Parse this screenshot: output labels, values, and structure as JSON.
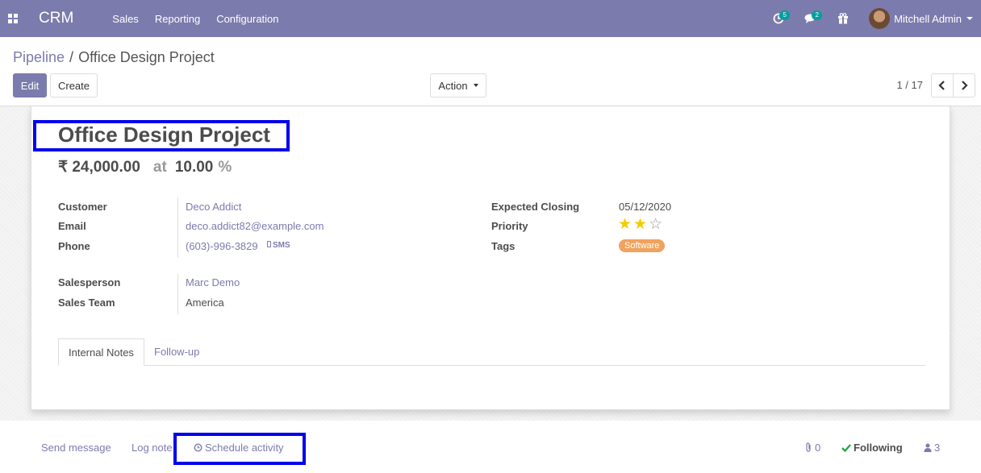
{
  "navbar": {
    "brand": "CRM",
    "menu": [
      "Sales",
      "Reporting",
      "Configuration"
    ],
    "activity_count": "5",
    "message_count": "2",
    "user_name": "Mitchell Admin"
  },
  "control": {
    "breadcrumb_parent": "Pipeline",
    "breadcrumb_separator": "/",
    "breadcrumb_current": "Office Design Project",
    "edit_label": "Edit",
    "create_label": "Create",
    "action_label": "Action",
    "pager": "1 / 17"
  },
  "record": {
    "title": "Office Design Project",
    "revenue": "₹ 24,000.00",
    "at_label": "at",
    "probability": "10.00",
    "percent_sign": "%",
    "left_fields": [
      {
        "label": "Customer",
        "value": "Deco Addict"
      },
      {
        "label": "Email",
        "value": "deco.addict82@example.com"
      },
      {
        "label": "Phone",
        "value": "(603)-996-3829"
      },
      {
        "label": "Salesperson",
        "value": "Marc Demo"
      },
      {
        "label": "Sales Team",
        "value": "America"
      }
    ],
    "sms_label": "SMS",
    "right_fields": [
      {
        "label": "Expected Closing",
        "value": "05/12/2020"
      },
      {
        "label": "Priority",
        "value": 2,
        "max": 3
      },
      {
        "label": "Tags",
        "value": "Software"
      }
    ],
    "tag_color": "#f0a35e"
  },
  "tabs": [
    "Internal Notes",
    "Follow-up"
  ],
  "chatter": {
    "send_message": "Send message",
    "log_note": "Log note",
    "schedule_activity": "Schedule activity",
    "attachments": "0",
    "following": "Following",
    "followers": "3"
  },
  "colors": {
    "brand": "#7c7bad",
    "highlight": "#0000ee",
    "following": "#28a745"
  }
}
